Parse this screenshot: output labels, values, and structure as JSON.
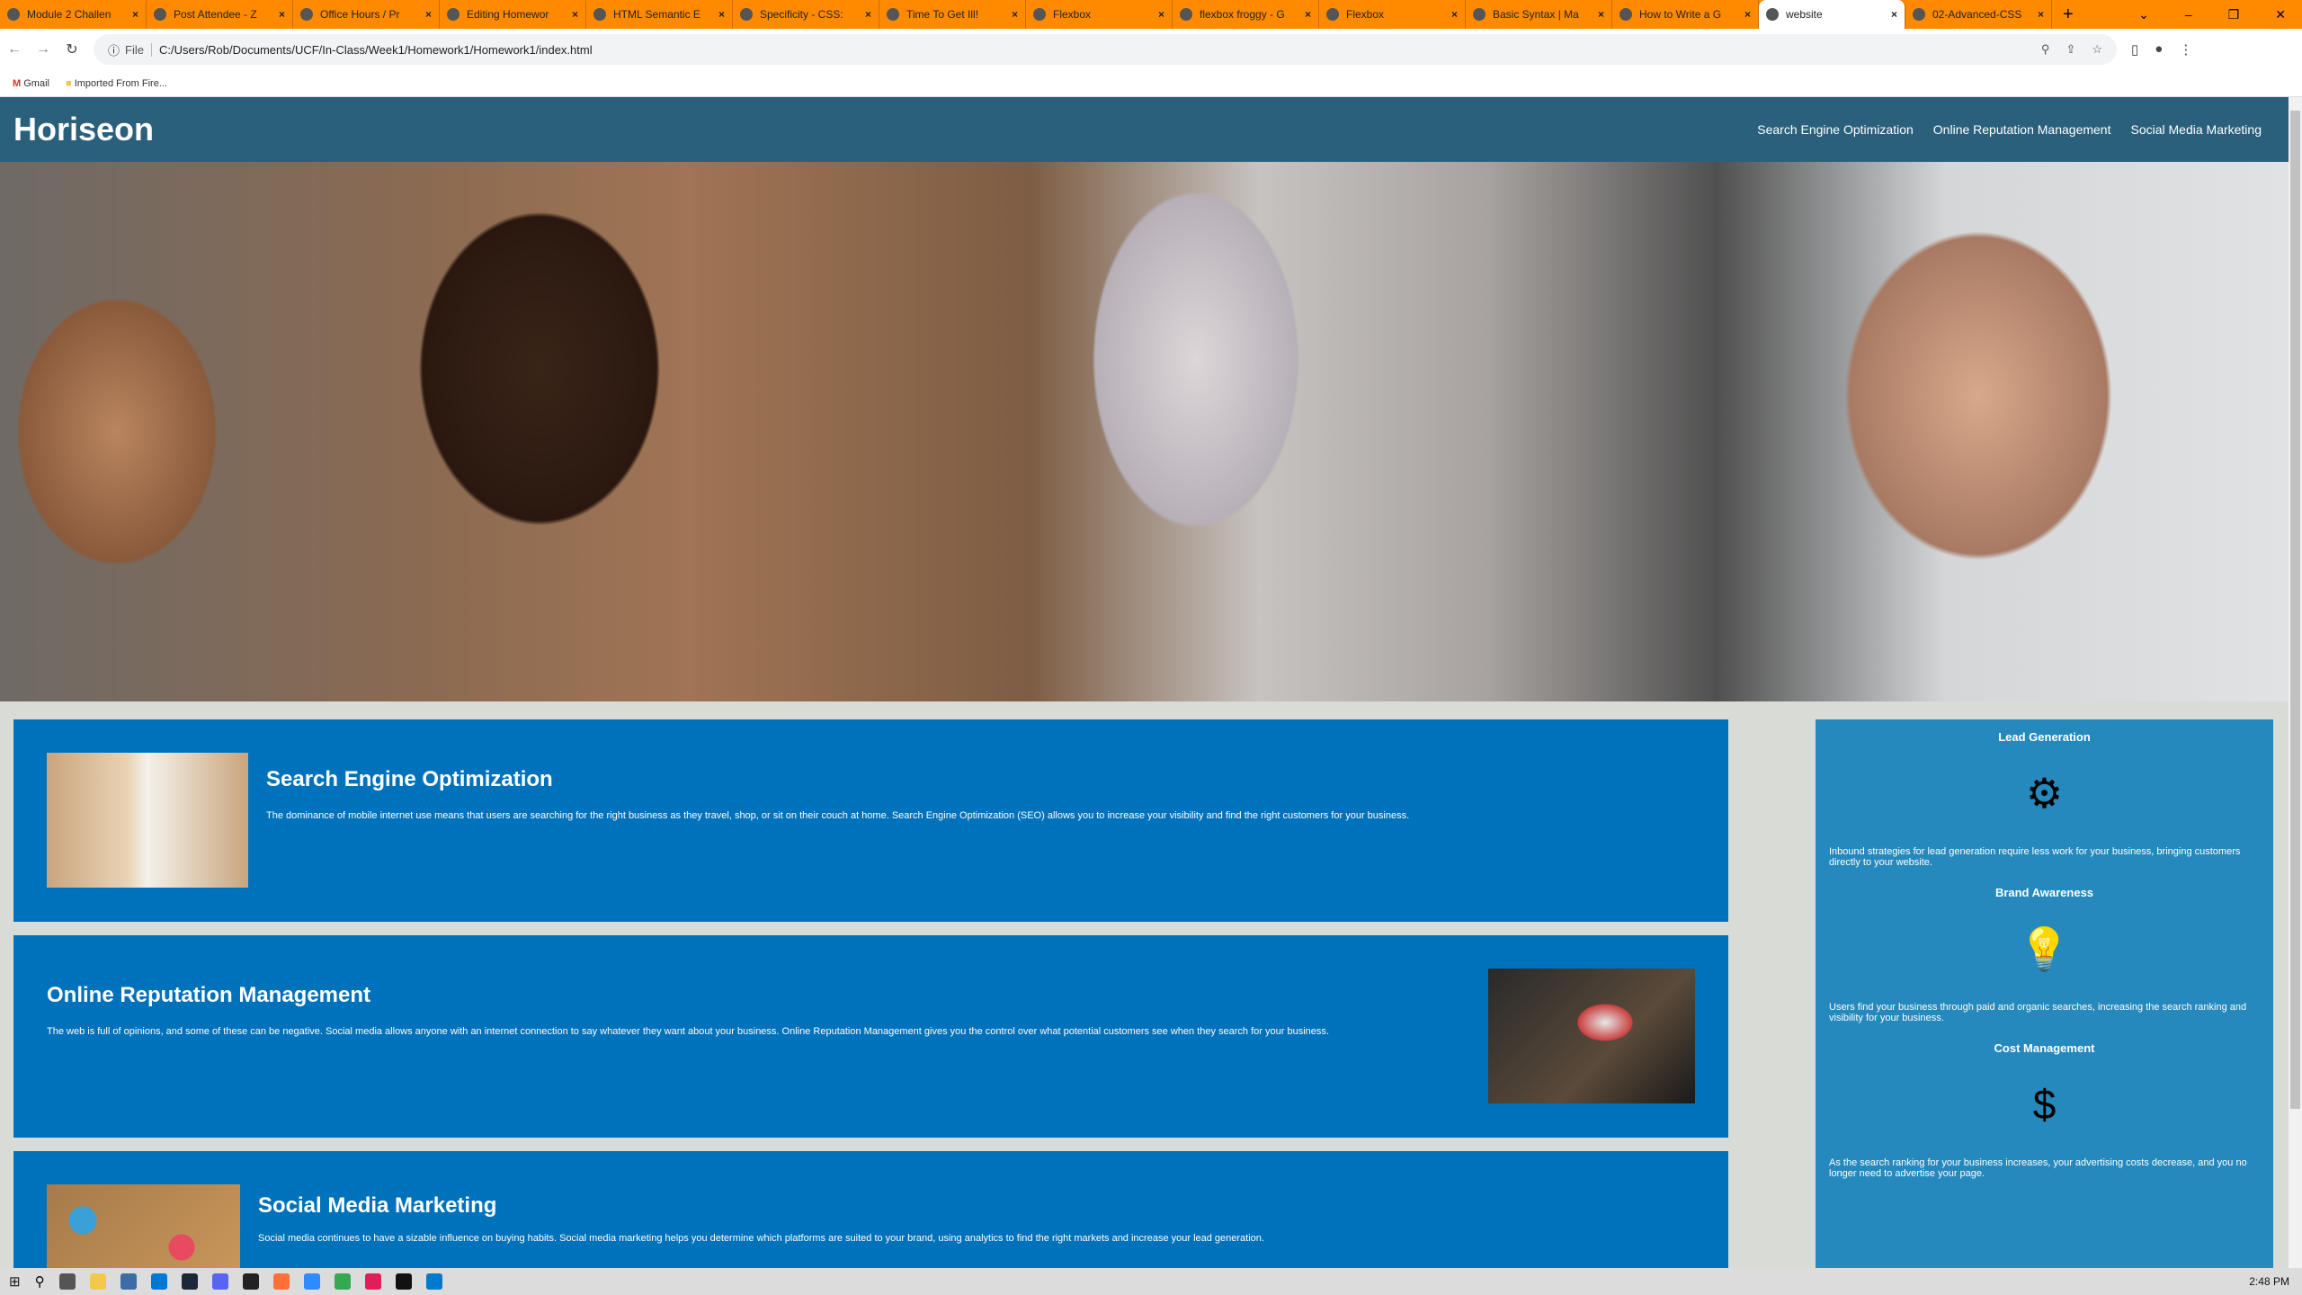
{
  "browser": {
    "tabs": [
      {
        "label": "Module 2 Challen",
        "icon": "module-icon"
      },
      {
        "label": "Post Attendee - Z",
        "icon": "zoom-icon"
      },
      {
        "label": "Office Hours / Pr",
        "icon": "sheets-icon"
      },
      {
        "label": "Editing Homewor",
        "icon": "github-icon"
      },
      {
        "label": "HTML Semantic E",
        "icon": "w3-icon"
      },
      {
        "label": "Specificity - CSS:",
        "icon": "mdn-icon"
      },
      {
        "label": "Time To Get Ill!",
        "icon": "globe-icon"
      },
      {
        "label": "Flexbox",
        "icon": "globe-icon"
      },
      {
        "label": "flexbox froggy - G",
        "icon": "google-icon"
      },
      {
        "label": "Flexbox",
        "icon": "globe-icon"
      },
      {
        "label": "Basic Syntax | Ma",
        "icon": "markdown-icon"
      },
      {
        "label": "How to Write a G",
        "icon": "article-icon"
      },
      {
        "label": "website",
        "icon": "globe-icon",
        "active": true
      },
      {
        "label": "02-Advanced-CSS",
        "icon": "gitlab-icon"
      }
    ],
    "file_label": "File",
    "url": "C:/Users/Rob/Documents/UCF/In-Class/Week1/Homework1/Homework1/index.html",
    "bookmarks": [
      "Gmail",
      "Imported From Fire..."
    ],
    "tab_color": "#ff8a00"
  },
  "site": {
    "title": "Horiseon",
    "nav": [
      "Search Engine Optimization",
      "Online Reputation Management",
      "Social Media Marketing"
    ],
    "colors": {
      "header": "#2a607c",
      "section": "#0072bb",
      "aside": "#2589bd",
      "background": "#d9dcd6"
    },
    "sections": [
      {
        "title": "Search Engine Optimization",
        "text": "The dominance of mobile internet use means that users are searching for the right business as they travel, shop, or sit on their couch at home. Search Engine Optimization (SEO) allows you to increase your visibility and find the right customers for your business."
      },
      {
        "title": "Online Reputation Management",
        "text": "The web is full of opinions, and some of these can be negative. Social media allows anyone with an internet connection to say whatever they want about your business. Online Reputation Management gives you the control over what potential customers see when they search for your business."
      },
      {
        "title": "Social Media Marketing",
        "text": "Social media continues to have a sizable influence on buying habits. Social media marketing helps you determine which platforms are suited to your brand, using analytics to find the right markets and increase your lead generation."
      }
    ],
    "benefits": [
      {
        "title": "Lead Generation",
        "icon": "funnel-gear-icon",
        "text": "Inbound strategies for lead generation require less work for your business, bringing customers directly to your website."
      },
      {
        "title": "Brand Awareness",
        "icon": "lightbulb-person-icon",
        "text": "Users find your business through paid and organic searches, increasing the search ranking and visibility for your business."
      },
      {
        "title": "Cost Management",
        "icon": "gear-coins-icon",
        "text": "As the search ranking for your business increases, your advertising costs decrease, and you no longer need to advertise your page."
      }
    ]
  },
  "taskbar": {
    "clock": "2:48 PM"
  }
}
